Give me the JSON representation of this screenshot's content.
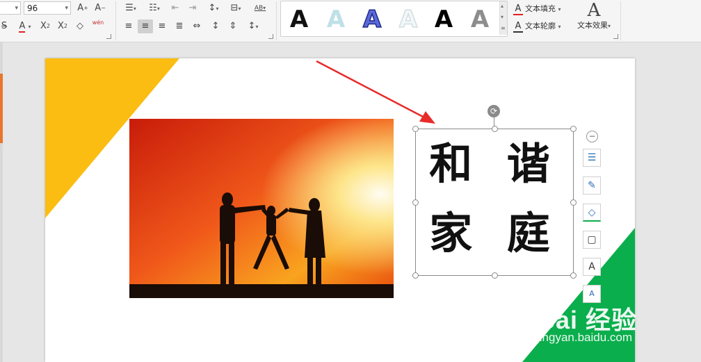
{
  "ribbon": {
    "font_size": "96",
    "font_size_placeholder": "96",
    "font_buttons": {
      "grow": "A",
      "shrink": "A",
      "strike": "S",
      "font_color": "A",
      "superscript": "X",
      "subscript": "X",
      "clear_format": "◇",
      "phonetic": "wén"
    },
    "paragraph_buttons": [
      "≡",
      "≡",
      "⇤",
      "⇥",
      "↕",
      "⊟",
      "AB"
    ],
    "align_buttons": [
      "≡",
      "≡",
      "≡",
      "≡",
      "↔",
      "↕",
      "↕",
      "↕"
    ],
    "wordart_styles": [
      {
        "glyph": "A",
        "color": "#111111",
        "stroke": "none"
      },
      {
        "glyph": "A",
        "color": "#bfe0e6",
        "stroke": "none"
      },
      {
        "glyph": "A",
        "color": "#5c6ad8",
        "stroke": "#1e2a8a"
      },
      {
        "glyph": "A",
        "color": "#f2f7f8",
        "stroke": "#d3dde0"
      },
      {
        "glyph": "A",
        "color": "#000000",
        "stroke": "none"
      },
      {
        "glyph": "A",
        "color": "#8d8d8d",
        "stroke": "none"
      }
    ],
    "text_fill_label": "文本填充",
    "text_outline_label": "文本轮廓",
    "text_effects_label": "文本效果",
    "text_effects_glyph": "A"
  },
  "slide": {
    "textbox_line1": "和 谐",
    "textbox_line2": "家 庭",
    "colors": {
      "yellow": "#fbbd12",
      "green": "#0aae4c",
      "arrow": "#e82b2b"
    }
  },
  "floating_toolbar": {
    "collapse": "−",
    "buttons": [
      {
        "name": "layers-icon",
        "glyph": "☰"
      },
      {
        "name": "brush-icon",
        "glyph": "✎"
      },
      {
        "name": "shape-fill-icon",
        "glyph": "◇"
      },
      {
        "name": "shape-outline-icon",
        "glyph": "▢"
      },
      {
        "name": "text-fill-icon",
        "glyph": "A"
      },
      {
        "name": "text-style-icon",
        "glyph": "A"
      }
    ]
  },
  "watermark": {
    "logo": "Bai 经验",
    "url": "jingyan.baidu.com"
  }
}
